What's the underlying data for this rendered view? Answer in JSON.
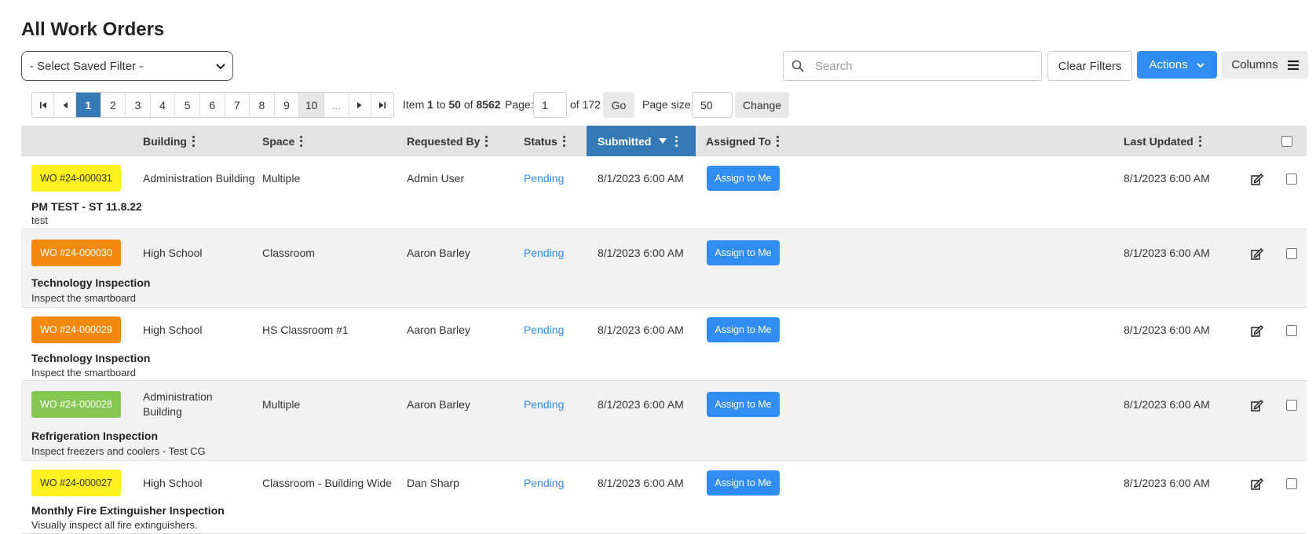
{
  "page_title": "All Work Orders",
  "saved_filter": {
    "selected": "- Select Saved Filter -"
  },
  "search": {
    "placeholder": "Search"
  },
  "toolbar": {
    "clear_filters": "Clear Filters",
    "actions": "Actions",
    "columns": "Columns"
  },
  "pagination": {
    "pages": [
      "1",
      "2",
      "3",
      "4",
      "5",
      "6",
      "7",
      "8",
      "9",
      "10",
      "..."
    ],
    "item_prefix": "Item",
    "item_from": "1",
    "item_to_word": "to",
    "item_to": "50",
    "item_of_word": "of",
    "item_total": "8562",
    "page_label": "Page:",
    "page_value": "1",
    "page_of": "of 172",
    "go_label": "Go",
    "page_size_label": "Page size:",
    "page_size_value": "50",
    "change_label": "Change"
  },
  "columns": {
    "building": "Building",
    "space": "Space",
    "requested_by": "Requested By",
    "status": "Status",
    "submitted": "Submitted",
    "assigned_to": "Assigned To",
    "last_updated": "Last Updated"
  },
  "colors": {
    "yellow": "#fff01f",
    "orange": "#f38a0f",
    "green": "#84c853",
    "accent": "#2f8cf0",
    "sorted_header": "#337ab7"
  },
  "rows": [
    {
      "wo": "WO #24-000031",
      "wo_color": "yellow",
      "building": "Administration Building",
      "space": "Multiple",
      "requested_by": "Admin User",
      "status": "Pending",
      "submitted": "8/1/2023 6:00 AM",
      "assign_label": "Assign to Me",
      "last_updated": "8/1/2023 6:00 AM",
      "title": "PM TEST - ST 11.8.22",
      "description": "test"
    },
    {
      "wo": "WO #24-000030",
      "wo_color": "orange",
      "building": "High School",
      "space": "Classroom",
      "requested_by": "Aaron Barley",
      "status": "Pending",
      "submitted": "8/1/2023 6:00 AM",
      "assign_label": "Assign to Me",
      "last_updated": "8/1/2023 6:00 AM",
      "title": "Technology Inspection",
      "description": "Inspect the smartboard"
    },
    {
      "wo": "WO #24-000029",
      "wo_color": "orange",
      "building": "High School",
      "space": "HS Classroom #1",
      "requested_by": "Aaron Barley",
      "status": "Pending",
      "submitted": "8/1/2023 6:00 AM",
      "assign_label": "Assign to Me",
      "last_updated": "8/1/2023 6:00 AM",
      "title": "Technology Inspection",
      "description": "Inspect the smartboard"
    },
    {
      "wo": "WO #24-000028",
      "wo_color": "green",
      "building": "Administration\nBuilding",
      "space": "Multiple",
      "requested_by": "Aaron Barley",
      "status": "Pending",
      "submitted": "8/1/2023 6:00 AM",
      "assign_label": "Assign to Me",
      "last_updated": "8/1/2023 6:00 AM",
      "title": "Refrigeration Inspection",
      "description": "Inspect freezers and coolers - Test CG"
    },
    {
      "wo": "WO #24-000027",
      "wo_color": "yellow",
      "building": "High School",
      "space": "Classroom - Building Wide",
      "requested_by": "Dan Sharp",
      "status": "Pending",
      "submitted": "8/1/2023 6:00 AM",
      "assign_label": "Assign to Me",
      "last_updated": "8/1/2023 6:00 AM",
      "title": "Monthly Fire Extinguisher Inspection",
      "description": "Visually inspect all fire extinguishers."
    }
  ]
}
